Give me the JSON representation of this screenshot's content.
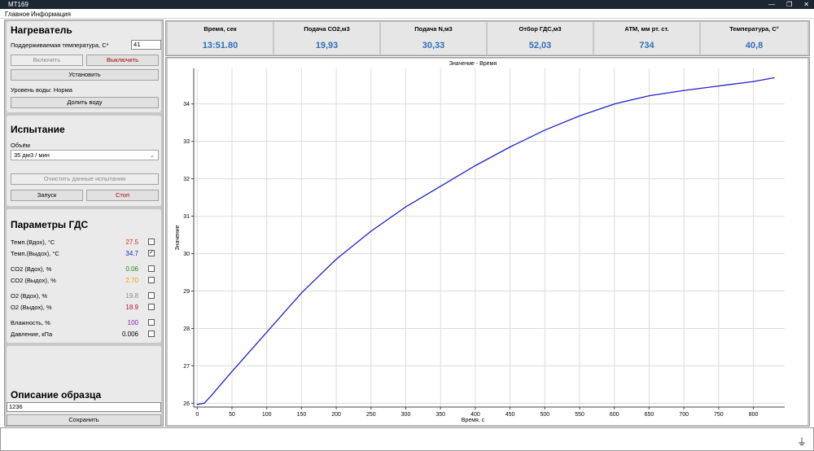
{
  "window": {
    "title": "MT169",
    "controls": [
      "—",
      "❐",
      "✕"
    ]
  },
  "menu": {
    "items": [
      "Главное",
      "Информация"
    ]
  },
  "heater": {
    "title": "Нагреватель",
    "temp_label": "Поддерживаемая температура, С*",
    "temp_value": "41",
    "enable": "Включить",
    "disable": "Выключить",
    "set": "Установить",
    "water_level": "Уровень воды: Норма",
    "add_water": "Долить воду"
  },
  "test": {
    "title": "Испытание",
    "volume_label": "Объём",
    "volume_value": "35 дм3 / мин",
    "clear": "Очистить данные испытания",
    "start": "Запуск",
    "stop": "Стоп"
  },
  "gds": {
    "title": "Параметры ГДС",
    "params": [
      {
        "label": "Темп.(Вдох), °С",
        "value": "27.5",
        "color": "#e02020",
        "checked": false
      },
      {
        "label": "Темп.(Выдох), °С",
        "value": "34.7",
        "color": "#2020d0",
        "checked": true
      },
      {
        "label": "СО2 (Вдох), %",
        "value": "0.06",
        "color": "#1a8a1a",
        "checked": false
      },
      {
        "label": "СО2 (Выдох), %",
        "value": "2.70",
        "color": "#e8a000",
        "checked": false
      },
      {
        "label": "О2 (Вдох), %",
        "value": "19.8",
        "color": "#8a8a8a",
        "checked": false
      },
      {
        "label": "О2 (Выдох), %",
        "value": "18.9",
        "color": "#b01030",
        "checked": false
      },
      {
        "label": "Влажность, %",
        "value": "100",
        "color": "#7a20b0",
        "checked": false
      },
      {
        "label": "Давление, кПа",
        "value": "0.006",
        "color": "#000000",
        "checked": false
      }
    ]
  },
  "sample": {
    "title": "Описание образца",
    "value": "1236",
    "save": "Сохранить"
  },
  "readouts": {
    "columns": [
      {
        "header": "Время, сек",
        "value": "13:51.80"
      },
      {
        "header": "Подача СО2,м3",
        "value": "19,93"
      },
      {
        "header": "Подача N,м3",
        "value": "30,33"
      },
      {
        "header": "Отбор ГДС,м3",
        "value": "52,03"
      },
      {
        "header": "АТМ, мм рт. ст.",
        "value": "734"
      },
      {
        "header": "Температура, С°",
        "value": "40,8"
      }
    ]
  },
  "chart_data": {
    "type": "line",
    "title": "Значение - Время",
    "xlabel": "Время, с",
    "ylabel": "Значение",
    "xlim": [
      -5,
      845
    ],
    "ylim": [
      25.9,
      34.95
    ],
    "xticks": [
      0,
      50,
      100,
      150,
      200,
      250,
      300,
      350,
      400,
      450,
      500,
      550,
      600,
      650,
      700,
      750,
      800
    ],
    "yticks": [
      26,
      27,
      28,
      29,
      30,
      31,
      32,
      33,
      34
    ],
    "grid": true,
    "series": [
      {
        "color": "#2020d0",
        "x": [
          0,
          10,
          20,
          50,
          100,
          150,
          200,
          250,
          300,
          350,
          400,
          450,
          500,
          550,
          600,
          650,
          700,
          750,
          800,
          830
        ],
        "y": [
          25.97,
          26.0,
          26.2,
          26.85,
          27.9,
          28.95,
          29.85,
          30.6,
          31.25,
          31.8,
          32.35,
          32.85,
          33.3,
          33.68,
          34.0,
          34.22,
          34.36,
          34.48,
          34.6,
          34.7
        ]
      }
    ]
  },
  "status": {
    "plug_icon": "⏚"
  }
}
